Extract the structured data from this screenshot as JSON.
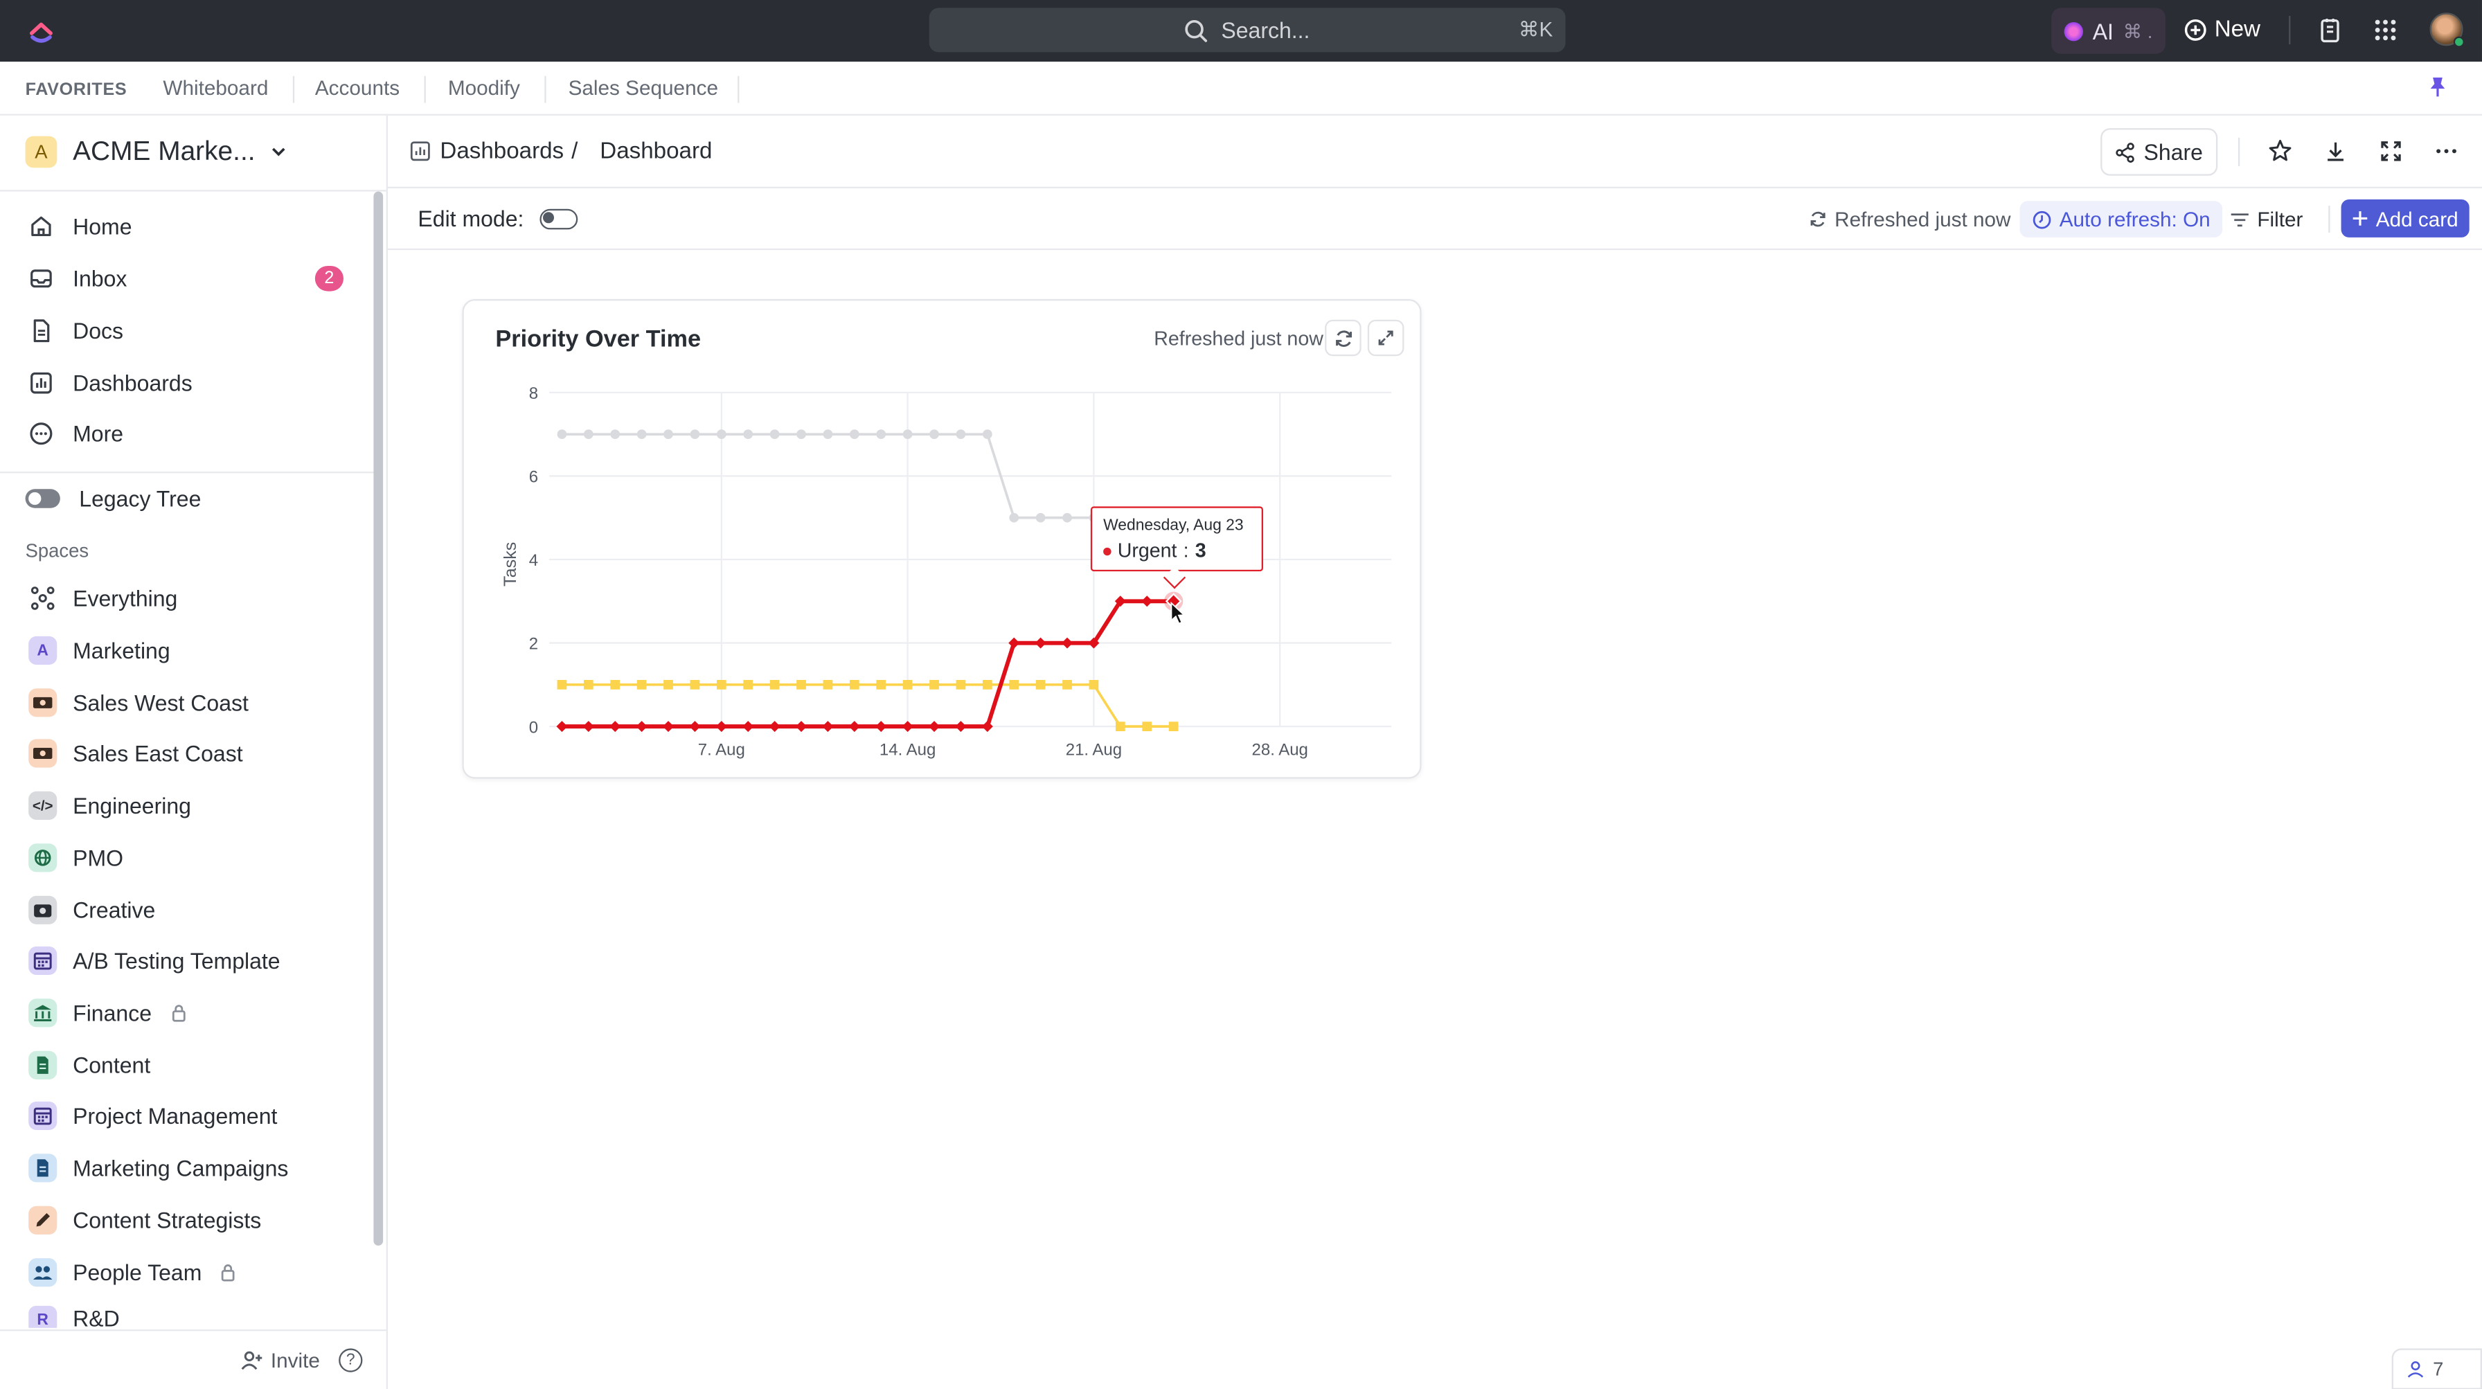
{
  "topbar": {
    "search_placeholder": "Search...",
    "search_shortcut": "⌘K",
    "ai_label": "AI",
    "ai_shortcut": "⌘ .",
    "new_label": "New"
  },
  "favorites": {
    "label": "FAVORITES",
    "items": [
      "Whiteboard",
      "Accounts",
      "Moodify",
      "Sales Sequence"
    ]
  },
  "sidebar": {
    "workspace_initial": "A",
    "workspace_name": "ACME Marke...",
    "nav": [
      {
        "label": "Home",
        "icon": "home-icon"
      },
      {
        "label": "Inbox",
        "icon": "inbox-icon",
        "badge": "2"
      },
      {
        "label": "Docs",
        "icon": "docs-icon"
      },
      {
        "label": "Dashboards",
        "icon": "dashboards-icon"
      },
      {
        "label": "More",
        "icon": "more-icon"
      }
    ],
    "legacy_tree": "Legacy Tree",
    "spaces_label": "Spaces",
    "spaces": [
      {
        "label": "Everything",
        "icon": "everything-icon",
        "color": "#ffffff",
        "fg": "#3b4048"
      },
      {
        "label": "Marketing",
        "icon": "A",
        "color": "#d9d3f7",
        "fg": "#5b47c9"
      },
      {
        "label": "Sales West Coast",
        "icon": "money-icon",
        "color": "#fbd6bf",
        "fg": "#3a2a20"
      },
      {
        "label": "Sales East Coast",
        "icon": "money-icon",
        "color": "#fbd6bf",
        "fg": "#3a2a20"
      },
      {
        "label": "Engineering",
        "icon": "</>",
        "color": "#d8dadd",
        "fg": "#2a2e34"
      },
      {
        "label": "PMO",
        "icon": "globe-icon",
        "color": "#cdeee0",
        "fg": "#1e6b47"
      },
      {
        "label": "Creative",
        "icon": "camera-icon",
        "color": "#d8dadd",
        "fg": "#2a2e34"
      },
      {
        "label": "A/B Testing Template",
        "icon": "calendar-icon",
        "color": "#d9d3f7",
        "fg": "#3a2f80"
      },
      {
        "label": "Finance",
        "icon": "bank-icon",
        "color": "#cdeee0",
        "fg": "#1e6b47",
        "locked": true
      },
      {
        "label": "Content",
        "icon": "doc-icon",
        "color": "#cdeee0",
        "fg": "#1e6b47"
      },
      {
        "label": "Project Management",
        "icon": "calendar-icon",
        "color": "#d9d3f7",
        "fg": "#3a2f80"
      },
      {
        "label": "Marketing Campaigns",
        "icon": "doc-icon",
        "color": "#cfe4f7",
        "fg": "#1d4e7a"
      },
      {
        "label": "Content Strategists",
        "icon": "pencil-icon",
        "color": "#fbd6bf",
        "fg": "#3a2a20"
      },
      {
        "label": "People Team",
        "icon": "people-icon",
        "color": "#cfe4f7",
        "fg": "#1d4e7a",
        "locked": true
      },
      {
        "label": "R&D",
        "icon": "R",
        "color": "#d9d3f7",
        "fg": "#5b47c9"
      }
    ],
    "invite_label": "Invite",
    "help_label": "?"
  },
  "header": {
    "breadcrumb_parent": "Dashboards",
    "breadcrumb_sep": "/",
    "breadcrumb_current": "Dashboard",
    "share_label": "Share"
  },
  "toolbar": {
    "edit_mode_label": "Edit mode:",
    "refreshed_label": "Refreshed just now",
    "auto_refresh_label": "Auto refresh: On",
    "filter_label": "Filter",
    "add_card_label": "Add card"
  },
  "card": {
    "title": "Priority Over Time",
    "refreshed_label": "Refreshed just now",
    "tooltip_date": "Wednesday, Aug 23",
    "tooltip_series": "Urgent",
    "tooltip_value": "3"
  },
  "chart_data": {
    "type": "line",
    "title": "Priority Over Time",
    "ylabel": "Tasks",
    "xlabel": "",
    "ylim": [
      0,
      8
    ],
    "yticks": [
      0,
      2,
      4,
      6,
      8
    ],
    "xtick_labels": [
      "7. Aug",
      "14. Aug",
      "21. Aug",
      "28. Aug"
    ],
    "x_start": "Aug 1",
    "x_end": "Aug 31",
    "series": [
      {
        "name": "",
        "color": "#d9dadd",
        "marker": "circle",
        "x": [
          1,
          2,
          3,
          4,
          5,
          6,
          7,
          8,
          9,
          10,
          11,
          12,
          13,
          14,
          15,
          16,
          17,
          18,
          19,
          20,
          21
        ],
        "values": [
          7,
          7,
          7,
          7,
          7,
          7,
          7,
          7,
          7,
          7,
          7,
          7,
          7,
          7,
          7,
          7,
          7,
          5,
          5,
          5,
          5
        ]
      },
      {
        "name": "",
        "color": "#fcd34d",
        "marker": "square",
        "x": [
          1,
          2,
          3,
          4,
          5,
          6,
          7,
          8,
          9,
          10,
          11,
          12,
          13,
          14,
          15,
          16,
          17,
          18,
          19,
          20,
          21,
          22,
          23,
          24
        ],
        "values": [
          1,
          1,
          1,
          1,
          1,
          1,
          1,
          1,
          1,
          1,
          1,
          1,
          1,
          1,
          1,
          1,
          1,
          1,
          1,
          1,
          1,
          0,
          0,
          0
        ]
      },
      {
        "name": "Urgent",
        "color": "#e0101a",
        "marker": "diamond",
        "x": [
          1,
          2,
          3,
          4,
          5,
          6,
          7,
          8,
          9,
          10,
          11,
          12,
          13,
          14,
          15,
          16,
          17,
          18,
          19,
          20,
          21,
          22,
          23,
          24
        ],
        "values": [
          0,
          0,
          0,
          0,
          0,
          0,
          0,
          0,
          0,
          0,
          0,
          0,
          0,
          0,
          0,
          0,
          0,
          2,
          2,
          2,
          2,
          3,
          3,
          3
        ]
      }
    ]
  },
  "footer_widget": {
    "count": "7"
  }
}
